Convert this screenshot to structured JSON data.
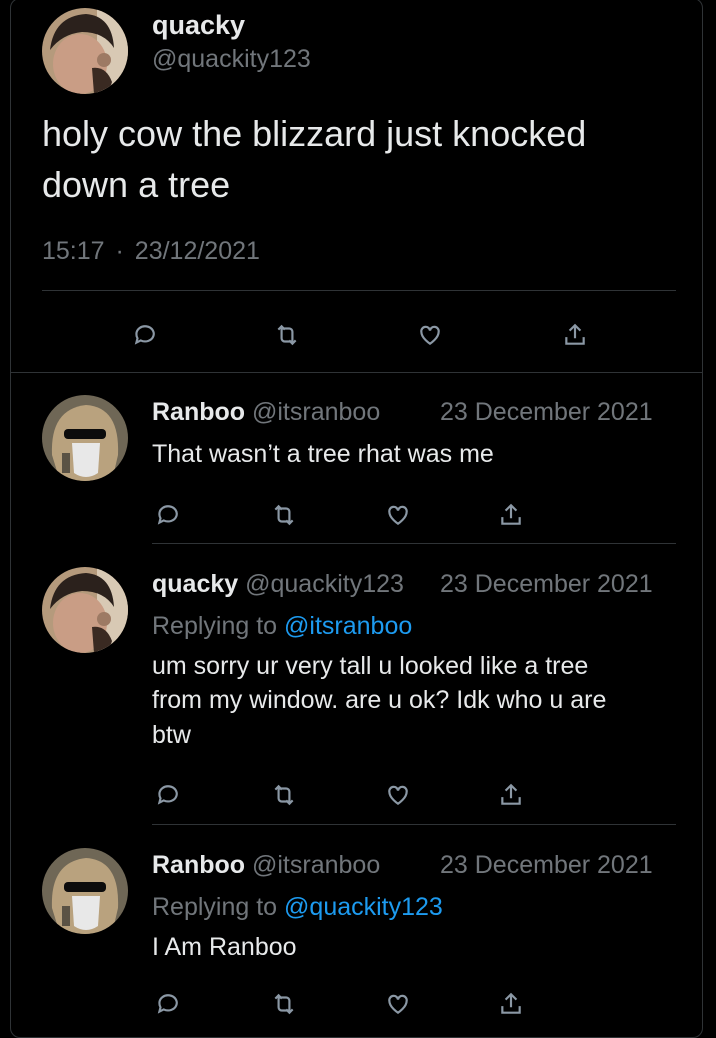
{
  "main_tweet": {
    "display_name": "quacky",
    "handle": "@quackity123",
    "text_line1": "holy cow the blizzard just knocked",
    "text_line2": "down a tree",
    "time": "15:17",
    "dot": "·",
    "date": "23/12/2021"
  },
  "replies": [
    {
      "display_name": "Ranboo",
      "handle": "@itsranboo",
      "date": "23 December 2021",
      "replying_prefix": "",
      "replying_to": "",
      "text_lines": [
        "That wasn’t a tree rhat was me"
      ]
    },
    {
      "display_name": "quacky",
      "handle": "@quackity123",
      "date": "23 December 2021",
      "replying_prefix": "Replying to",
      "replying_to": "@itsranboo",
      "text_lines": [
        "um sorry ur very tall u looked like a tree",
        "from my window. are u ok? Idk who u are",
        "btw"
      ]
    },
    {
      "display_name": "Ranboo",
      "handle": "@itsranboo",
      "date": "23 December 2021",
      "replying_prefix": "Replying to",
      "replying_to": "@quackity123",
      "text_lines": [
        "I Am Ranboo"
      ]
    }
  ],
  "icons": {
    "reply": "reply-icon",
    "retweet": "retweet-icon",
    "like": "like-icon",
    "share": "share-icon"
  },
  "colors": {
    "background": "#000000",
    "text": "#e7e9ea",
    "muted": "#71767b",
    "link": "#1d9bf0",
    "divider": "#2f3336"
  }
}
